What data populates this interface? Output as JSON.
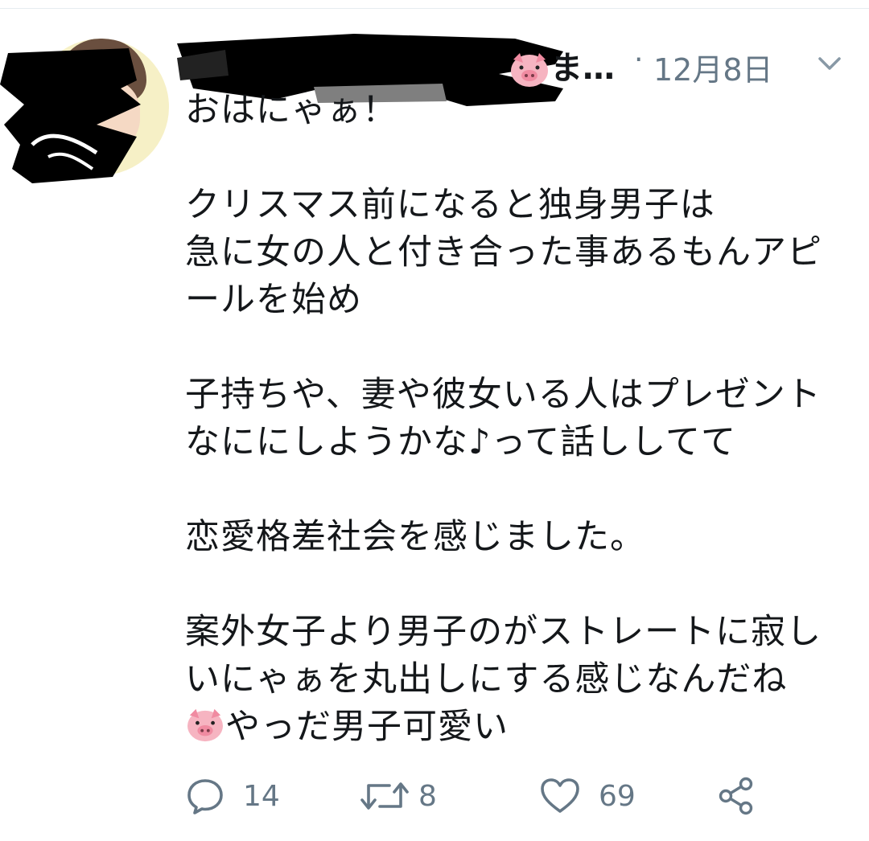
{
  "tweet": {
    "author": {
      "display_name_visible_end": "ま…",
      "avatar_icon": "user-avatar-redacted"
    },
    "timestamp": "12月8日",
    "separator": "·",
    "menu_icon": "chevron-down-icon",
    "body": "おはにゃぁ！\n\nクリスマス前になると独身男子は\n急に女の人と付き合った事あるもんアピ\nールを始め\n\n子持ちや、妻や彼女いる人はプレゼント\nなににしようかな♪って話ししてて\n\n恋愛格差社会を感じました。\n\n案外女子より男子のがストレートに寂し\nいにゃぁを丸出しにする感じなんだね\n",
    "body_last_line": "やっだ男子可愛い",
    "actions": {
      "replies": "14",
      "retweets": "8",
      "likes": "69"
    }
  },
  "colors": {
    "text": "#14171a",
    "secondary": "#657786",
    "redaction": "#000000",
    "pig": "#f4a7b6"
  }
}
